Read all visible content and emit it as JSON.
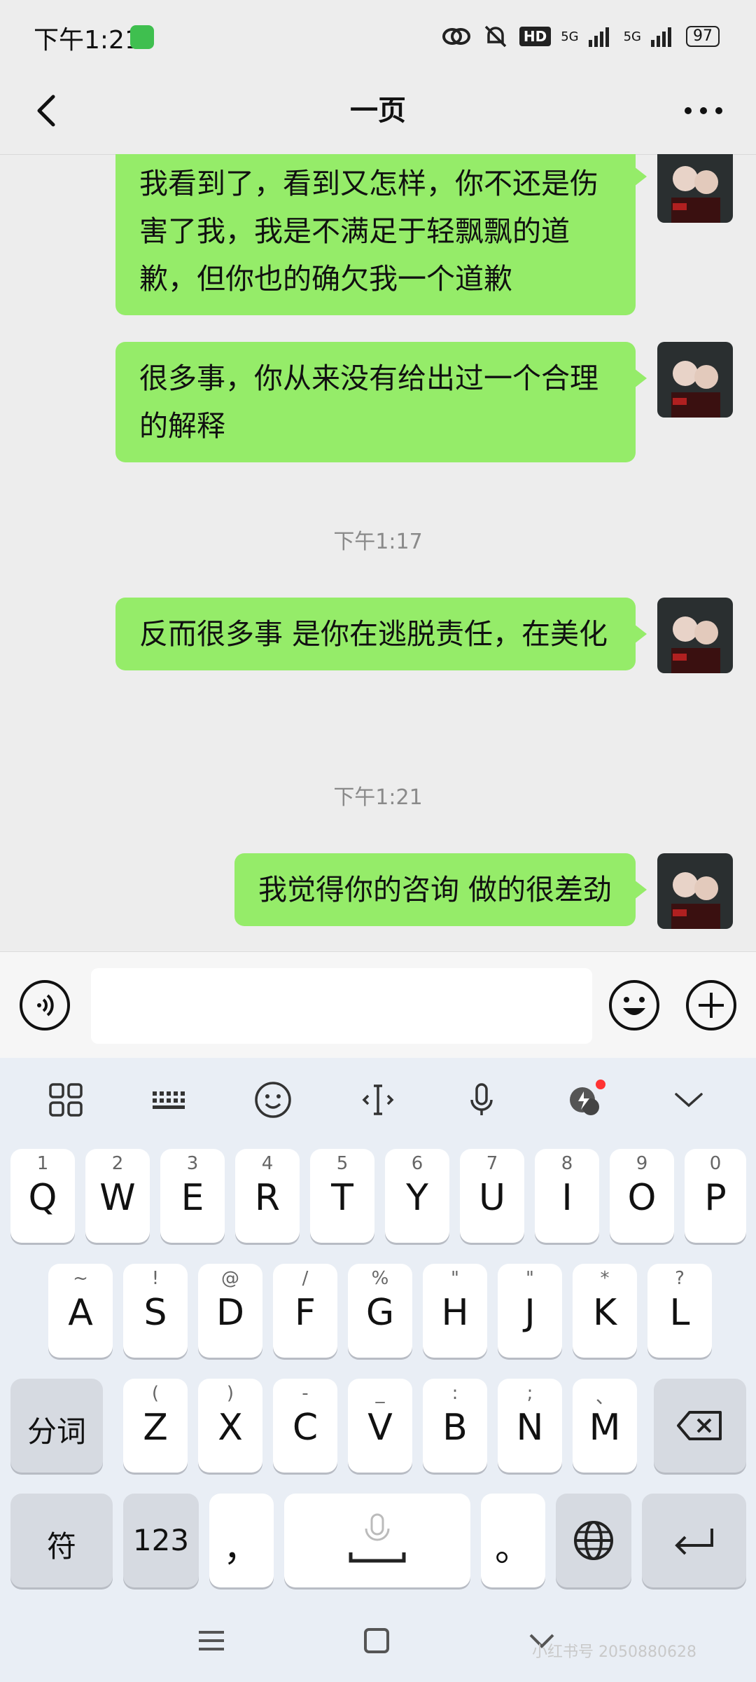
{
  "status_bar": {
    "time": "下午1:21",
    "hd": "HD",
    "net1": "5G",
    "net2": "5G",
    "battery": "97"
  },
  "header": {
    "title": "一页"
  },
  "messages": [
    {
      "text": "我看到了，看到又怎样，你不还是伤害了我，我是不满足于轻飘飘的道歉，但你也的确欠我一个道歉"
    },
    {
      "text": "很多事，你从来没有给出过一个合理的解释"
    },
    {
      "timestamp": "下午1:17"
    },
    {
      "text": "反而很多事 是你在逃脱责任，在美化"
    },
    {
      "timestamp": "下午1:21"
    },
    {
      "text": "我觉得你的咨询 做的很差劲"
    }
  ],
  "input": {
    "value": ""
  },
  "keyboard": {
    "row1": [
      {
        "k": "Q",
        "s": "1"
      },
      {
        "k": "W",
        "s": "2"
      },
      {
        "k": "E",
        "s": "3"
      },
      {
        "k": "R",
        "s": "4"
      },
      {
        "k": "T",
        "s": "5"
      },
      {
        "k": "Y",
        "s": "6"
      },
      {
        "k": "U",
        "s": "7"
      },
      {
        "k": "I",
        "s": "8"
      },
      {
        "k": "O",
        "s": "9"
      },
      {
        "k": "P",
        "s": "0"
      }
    ],
    "row2": [
      {
        "k": "A",
        "s": "~"
      },
      {
        "k": "S",
        "s": "!"
      },
      {
        "k": "D",
        "s": "@"
      },
      {
        "k": "F",
        "s": "/"
      },
      {
        "k": "G",
        "s": "%"
      },
      {
        "k": "H",
        "s": "\""
      },
      {
        "k": "J",
        "s": "\""
      },
      {
        "k": "K",
        "s": "*"
      },
      {
        "k": "L",
        "s": "?"
      }
    ],
    "row3": [
      {
        "k": "Z",
        "s": "("
      },
      {
        "k": "X",
        "s": ")"
      },
      {
        "k": "C",
        "s": "-"
      },
      {
        "k": "V",
        "s": "_"
      },
      {
        "k": "B",
        "s": ":"
      },
      {
        "k": "N",
        "s": ";"
      },
      {
        "k": "M",
        "s": "、"
      }
    ],
    "fenci": "分词",
    "fu": "符",
    "num": "123",
    "comma": "，",
    "period": "。"
  },
  "watermark": "小红书号 2050880628"
}
